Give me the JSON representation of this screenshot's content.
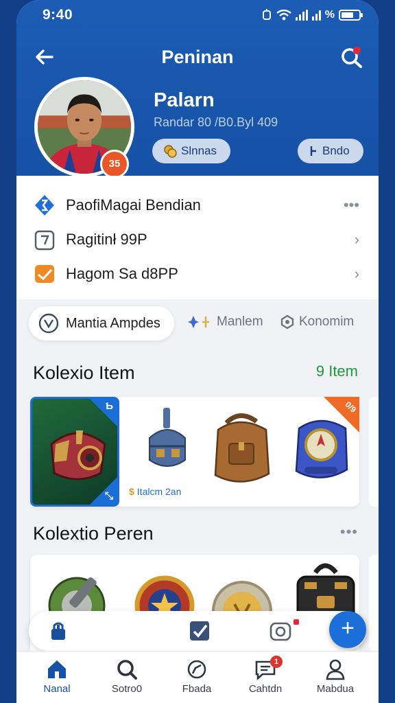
{
  "status_bar": {
    "time": "9:40",
    "battery_label": "%"
  },
  "header": {
    "title": "Peninan",
    "back_icon": "arrow-left-icon",
    "search_icon": "search-icon",
    "colors": {
      "primary": "#1652a6",
      "accent": "#e8562a"
    }
  },
  "profile": {
    "name": "Palarn",
    "subtitle": "Randar 80 /B0.Byl 409",
    "badge": "35",
    "pills": [
      {
        "label": "Slnnas",
        "icon": "coin-icon"
      },
      {
        "label": "Bndo",
        "icon": "edit-icon"
      }
    ]
  },
  "menu": [
    {
      "label": "PaofiMagai Bendian",
      "icon": "diamond-icon",
      "trailing": "•••"
    },
    {
      "label": "Ragitinł 99P",
      "icon": "box-icon",
      "trailing": "›"
    },
    {
      "label": "Hagom Sa d8PP",
      "icon": "mail-icon",
      "trailing": "›"
    }
  ],
  "tabs": [
    {
      "label": "Mantia Ampdes",
      "icon": "shield-icon",
      "active": true
    },
    {
      "label": "Manlem",
      "icon": "sparkle-icon",
      "active": false
    },
    {
      "label": "Konomim",
      "icon": "gear-icon",
      "active": false
    }
  ],
  "collection_items": {
    "title": "Kolexio Item",
    "count": "9 Item",
    "caption": "Italcm 2an",
    "ribbon": "0/9"
  },
  "collection_people": {
    "title": "Kolextio Peren",
    "more": "•••"
  },
  "action_bar": {
    "fab_label": "+"
  },
  "bottom_nav": [
    {
      "label": "Nanal",
      "icon": "home-icon",
      "active": true
    },
    {
      "label": "Sotro0",
      "icon": "search-icon",
      "active": false
    },
    {
      "label": "Fbada",
      "icon": "explore-icon",
      "active": false
    },
    {
      "label": "Cahtdn",
      "icon": "chat-icon",
      "active": false,
      "badge": "1"
    },
    {
      "label": "Mabdua",
      "icon": "profile-icon",
      "active": false
    }
  ]
}
